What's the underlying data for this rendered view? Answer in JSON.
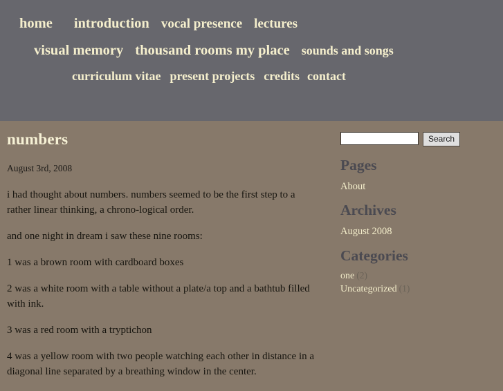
{
  "nav": {
    "rows": [
      [
        {
          "label": "home",
          "size": "sz-20",
          "gap": "gap-lg"
        },
        {
          "label": "introduction",
          "size": "sz-20",
          "gap": "gap-md"
        },
        {
          "label": "vocal presence",
          "size": "sz-19",
          "gap": "gap-md"
        },
        {
          "label": "lectures",
          "size": "sz-19",
          "gap": ""
        }
      ],
      [
        {
          "label": "visual memory",
          "size": "sz-20",
          "gap": "gap-md"
        },
        {
          "label": "thousand rooms my place",
          "size": "sz-20",
          "gap": "gap-md"
        },
        {
          "label": "sounds and songs",
          "size": "sz-18",
          "gap": ""
        }
      ],
      [
        {
          "label": "curriculum vitae",
          "size": "sz-18",
          "gap": "gap-sm"
        },
        {
          "label": "present projects",
          "size": "sz-18",
          "gap": "gap-sm"
        },
        {
          "label": "credits",
          "size": "sz-18",
          "gap": "gap-xs"
        },
        {
          "label": "contact",
          "size": "sz-18",
          "gap": ""
        }
      ]
    ]
  },
  "post": {
    "title": "numbers",
    "date": "August 3rd, 2008",
    "paragraphs": [
      "i had thought about numbers. numbers seemed to be the first step to a rather linear thinking, a chrono-logical order.",
      "and one night in dream i saw these nine rooms:",
      "1 was a brown room with cardboard boxes",
      "2 was a white room with a table without a plate/a top and a bathtub filled with ink.",
      "3 was a red room with a tryptichon",
      "4 was a yellow room with two people watching each other in distance in a diagonal line separated by a breathing window in the center."
    ]
  },
  "sidebar": {
    "search": {
      "value": "",
      "placeholder": "",
      "button_label": "Search"
    },
    "sections": [
      {
        "heading": "Pages",
        "items": [
          {
            "label": "About",
            "count": ""
          }
        ]
      },
      {
        "heading": "Archives",
        "items": [
          {
            "label": "August 2008",
            "count": ""
          }
        ]
      },
      {
        "heading": "Categories",
        "items": [
          {
            "label": "one",
            "count": "(2)"
          },
          {
            "label": "Uncategorized",
            "count": "(1)"
          }
        ]
      }
    ]
  },
  "colors": {
    "header_bg": "#67676d",
    "body_bg": "#87796a",
    "link_cream": "#f4eecb",
    "heading_slate": "#4b4a51",
    "body_text": "#17150f"
  }
}
